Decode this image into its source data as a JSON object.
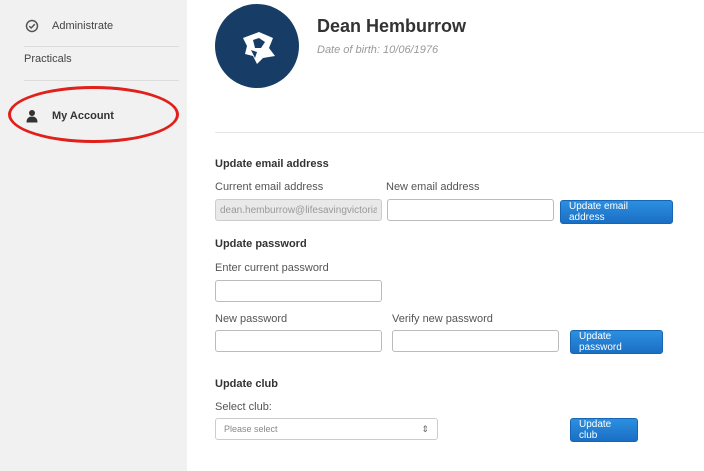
{
  "sidebar": {
    "items": [
      {
        "label": "Administrate",
        "icon": "check-circle-icon"
      },
      {
        "label": "Practicals"
      },
      {
        "label": "My Account",
        "icon": "user-icon"
      }
    ],
    "highlight_color": "#e0201a"
  },
  "profile": {
    "name": "Dean Hemburrow",
    "dob": "Date of birth: 10/06/1976"
  },
  "email": {
    "title": "Update email address",
    "current_label": "Current email address",
    "current_value": "dean.hemburrow@lifesavingvictoria",
    "new_label": "New email address",
    "new_value": "",
    "button": "Update email address"
  },
  "password": {
    "title": "Update password",
    "current_label": "Enter current password",
    "new_label": "New password",
    "verify_label": "Verify new password",
    "button": "Update password"
  },
  "club": {
    "title": "Update club",
    "select_label": "Select club:",
    "select_value": "Please select",
    "button": "Update club"
  },
  "colors": {
    "accent": "#1a6fc4",
    "avatar_bg": "#173d67"
  }
}
